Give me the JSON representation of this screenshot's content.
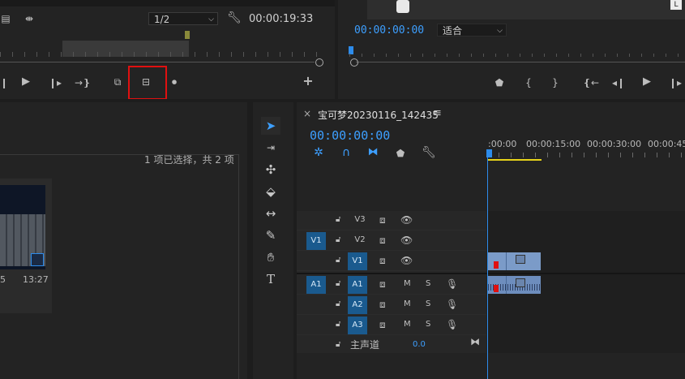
{
  "source_monitor": {
    "zoom_select": "1/2",
    "duration_timecode": "00:00:19:33"
  },
  "program_monitor": {
    "timecode": "00:00:00:00",
    "fit_select": "适合",
    "corner_badge": "L"
  },
  "project_panel": {
    "selection_status": "1 项已选择，共 2 项",
    "thumb_left_label": "5",
    "thumb_duration": "13:27"
  },
  "sequence": {
    "tab_close": "×",
    "tab_name": "宝可梦20230116_142435",
    "tab_menu": "≡",
    "timecode": "00:00:00:00",
    "ruler_labels": [
      ":00:00",
      "00:00:15:00",
      "00:00:30:00",
      "00:00:45:"
    ]
  },
  "tracks": {
    "video": [
      {
        "name": "V3",
        "source_patch": ""
      },
      {
        "name": "V2",
        "source_patch": "V1"
      },
      {
        "name": "V1",
        "source_patch": ""
      }
    ],
    "audio": [
      {
        "name": "A1",
        "source_patch": "A1",
        "m": "M",
        "s": "S"
      },
      {
        "name": "A2",
        "source_patch": "",
        "m": "M",
        "s": "S"
      },
      {
        "name": "A3",
        "source_patch": "",
        "m": "M",
        "s": "S"
      }
    ],
    "master_label": "主声道",
    "master_value": "0.0"
  },
  "accent_colors": {
    "timecode_blue": "#3d9fff",
    "highlight_red": "#e01010",
    "track_blue": "#1a5a8e",
    "clip_blue": "#7b9bc8",
    "work_area_yellow": "#e6d21a"
  }
}
